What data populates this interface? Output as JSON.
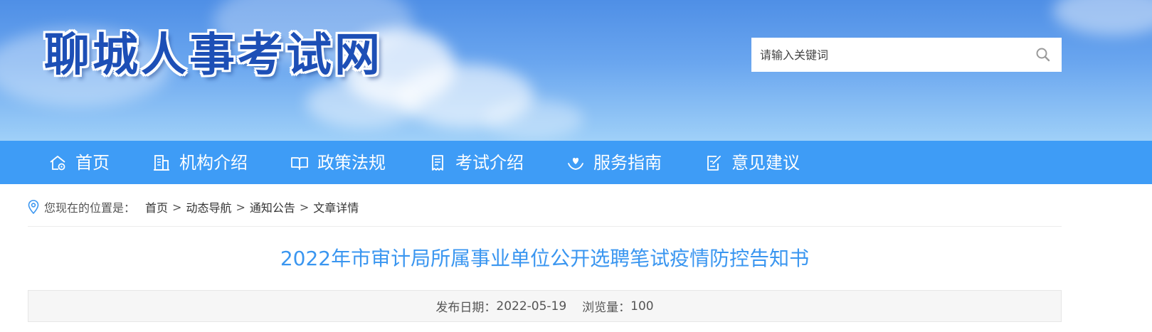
{
  "site": {
    "logo_text": "聊城人事考试网"
  },
  "search": {
    "placeholder": "请输入关键词",
    "icon": "search-icon"
  },
  "nav": {
    "items": [
      {
        "label": "首页",
        "icon": "home-icon"
      },
      {
        "label": "机构介绍",
        "icon": "building-icon"
      },
      {
        "label": "政策法规",
        "icon": "book-icon"
      },
      {
        "label": "考试介绍",
        "icon": "document-icon"
      },
      {
        "label": "服务指南",
        "icon": "heart-hand-icon"
      },
      {
        "label": "意见建议",
        "icon": "edit-icon"
      }
    ]
  },
  "breadcrumb": {
    "prefix": "您现在的位置是：",
    "separator": ">",
    "items": [
      "首页",
      "动态导航",
      "通知公告",
      "文章详情"
    ]
  },
  "article": {
    "title": "2022年市审计局所属事业单位公开选聘笔试疫情防控告知书",
    "date_label": "发布日期：",
    "date": "2022-05-19",
    "views_label": "浏览量：",
    "views": "100"
  },
  "colors": {
    "nav_background": "#3e9cf6",
    "title": "#3a96f0",
    "logo": "#1d4fb6"
  }
}
